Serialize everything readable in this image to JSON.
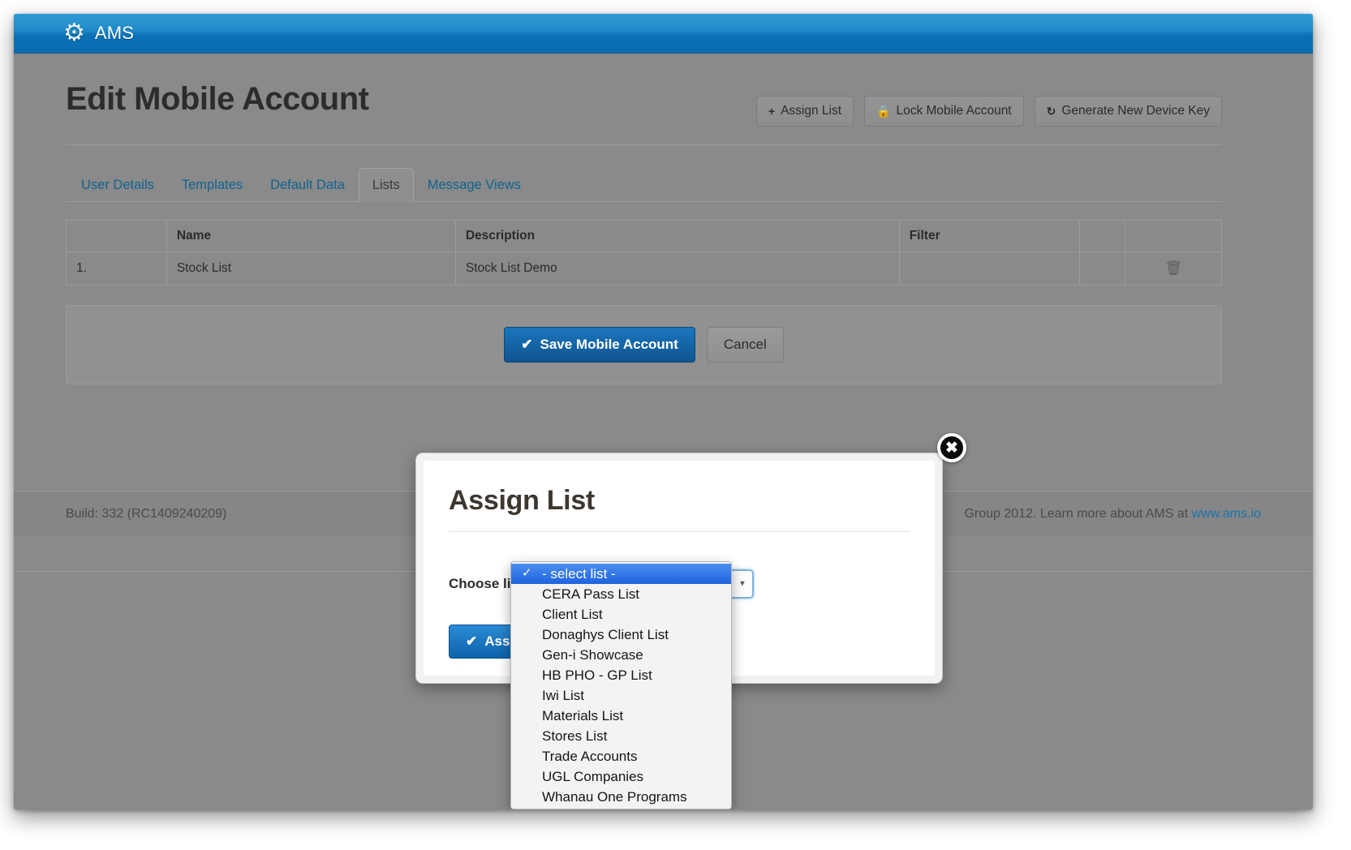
{
  "navbar": {
    "brand": "AMS",
    "gear_icon": "gear-icon"
  },
  "header": {
    "title": "Edit Mobile Account",
    "actions": [
      {
        "label": "Assign List",
        "icon": "plus-icon",
        "glyph": "+"
      },
      {
        "label": "Lock Mobile Account",
        "icon": "lock-icon",
        "glyph": "🔒"
      },
      {
        "label": "Generate New Device Key",
        "icon": "refresh-icon",
        "glyph": "↻"
      }
    ]
  },
  "tabs": [
    {
      "label": "User Details",
      "active": false
    },
    {
      "label": "Templates",
      "active": false
    },
    {
      "label": "Default Data",
      "active": false
    },
    {
      "label": "Lists",
      "active": true
    },
    {
      "label": "Message Views",
      "active": false
    }
  ],
  "table": {
    "headers": [
      "",
      "Name",
      "Description",
      "Filter",
      "",
      ""
    ],
    "rows": [
      {
        "index": "1.",
        "name": "Stock List",
        "description": "Stock List Demo",
        "filter": "",
        "spare": "",
        "delete_icon": "trash-icon",
        "delete_glyph": "🗑"
      }
    ]
  },
  "form_actions": {
    "save_label": "Save Mobile Account",
    "save_icon": "check-icon",
    "save_glyph": "✔",
    "cancel_label": "Cancel"
  },
  "footer": {
    "build": "Build: 332 (RC1409240209)",
    "copyright": "Group 2012. Learn more about AMS at",
    "link": "www.ams.io"
  },
  "modal": {
    "title": "Assign List",
    "close_icon": "close-icon",
    "close_glyph": "✖",
    "choose_label": "Choose list",
    "select_value": "",
    "select_caret": "▾",
    "assign_label": "Assign",
    "assign_icon": "check-icon",
    "assign_glyph": "✔"
  },
  "dropdown": {
    "check_glyph": "✓",
    "options": [
      {
        "label": "- select list -",
        "selected": true
      },
      {
        "label": "CERA Pass List",
        "selected": false
      },
      {
        "label": "Client List",
        "selected": false
      },
      {
        "label": "Donaghys Client List",
        "selected": false
      },
      {
        "label": "Gen-i Showcase",
        "selected": false
      },
      {
        "label": "HB PHO - GP List",
        "selected": false
      },
      {
        "label": "Iwi List",
        "selected": false
      },
      {
        "label": "Materials List",
        "selected": false
      },
      {
        "label": "Stores List",
        "selected": false
      },
      {
        "label": "Trade Accounts",
        "selected": false
      },
      {
        "label": "UGL Companies",
        "selected": false
      },
      {
        "label": "Whanau One Programs",
        "selected": false
      }
    ]
  },
  "colors": {
    "navbar_blue": "#0b70b4",
    "primary_blue": "#10548f",
    "link_blue": "#1b74ad",
    "page_grey": "#8a8a8a"
  }
}
